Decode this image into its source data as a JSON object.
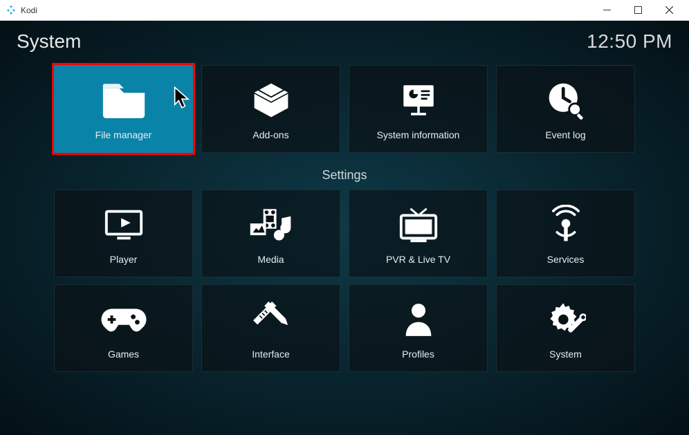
{
  "window": {
    "app_title": "Kodi"
  },
  "header": {
    "page_title": "System",
    "clock": "12:50 PM"
  },
  "sections": {
    "settings_label": "Settings"
  },
  "tiles": {
    "top": [
      {
        "id": "file-manager",
        "label": "File manager",
        "icon": "folder"
      },
      {
        "id": "addons",
        "label": "Add-ons",
        "icon": "box"
      },
      {
        "id": "system-info",
        "label": "System information",
        "icon": "presentation"
      },
      {
        "id": "event-log",
        "label": "Event log",
        "icon": "clock-search"
      }
    ],
    "settings": [
      {
        "id": "player",
        "label": "Player",
        "icon": "play-screen"
      },
      {
        "id": "media",
        "label": "Media",
        "icon": "media-collection"
      },
      {
        "id": "pvr",
        "label": "PVR & Live TV",
        "icon": "tv"
      },
      {
        "id": "services",
        "label": "Services",
        "icon": "broadcast"
      },
      {
        "id": "games",
        "label": "Games",
        "icon": "gamepad"
      },
      {
        "id": "interface",
        "label": "Interface",
        "icon": "ruler-pencil"
      },
      {
        "id": "profiles",
        "label": "Profiles",
        "icon": "person"
      },
      {
        "id": "system",
        "label": "System",
        "icon": "gear-wrench"
      }
    ]
  },
  "state": {
    "selected_tile": "file-manager",
    "highlighted_tile": "file-manager"
  }
}
